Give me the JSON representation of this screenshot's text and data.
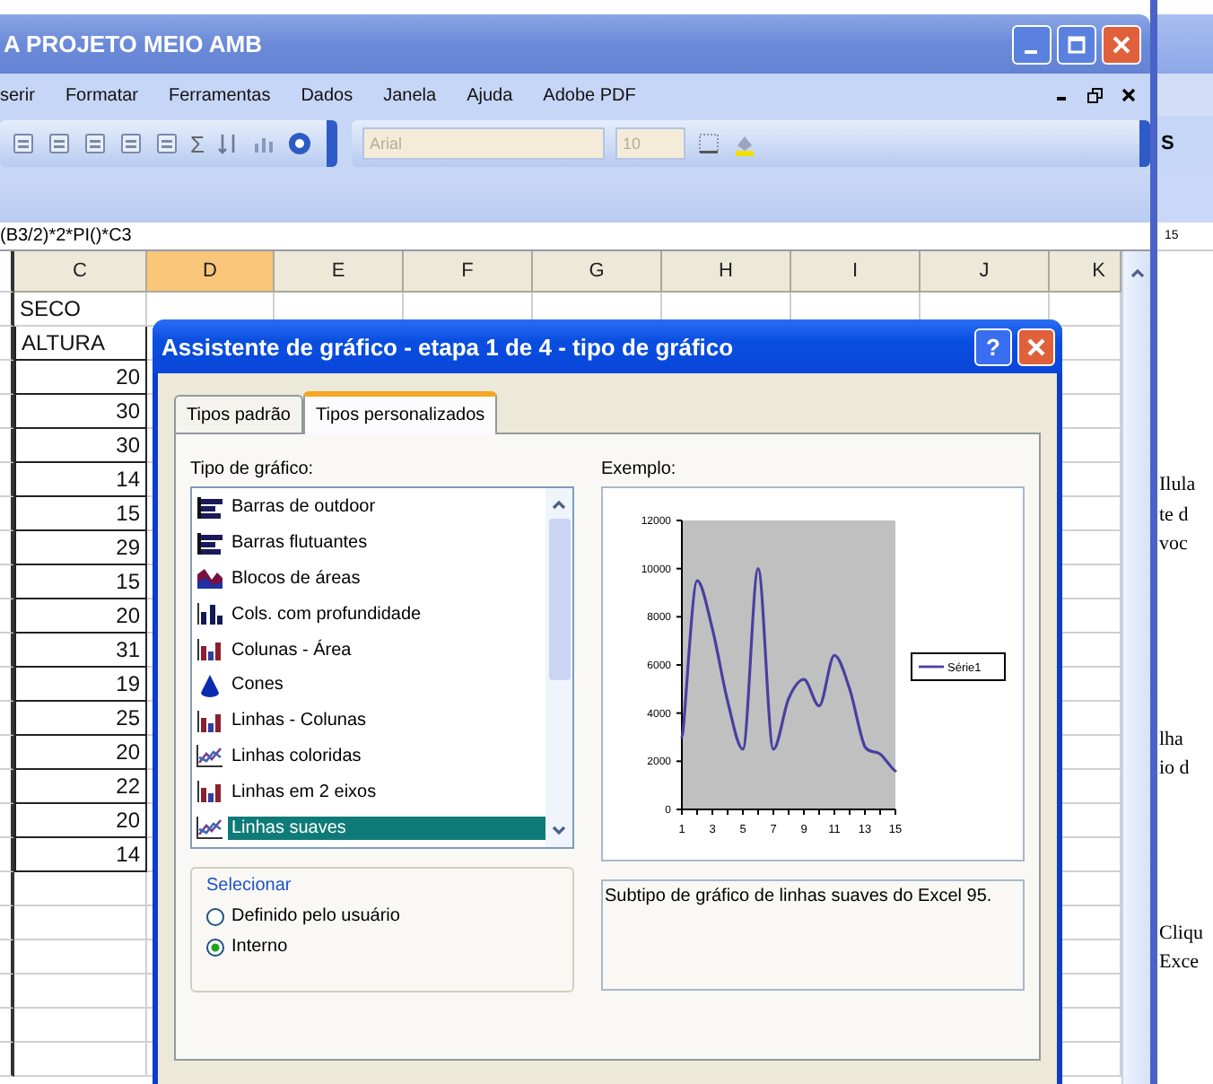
{
  "window": {
    "title": "A PROJETO MEIO AMB"
  },
  "menu": [
    "serir",
    "Formatar",
    "Ferramentas",
    "Dados",
    "Janela",
    "Ajuda",
    "Adobe PDF"
  ],
  "toolbar": {
    "sum_symbol": "Σ",
    "font": "Arial",
    "size": "10"
  },
  "formula_bar": {
    "formula": "(B3/2)*2*PI()*C3"
  },
  "sheet": {
    "columns": [
      {
        "label": "C",
        "selected": false
      },
      {
        "label": "D",
        "selected": true
      },
      {
        "label": "E",
        "selected": false
      },
      {
        "label": "F",
        "selected": false
      },
      {
        "label": "G",
        "selected": false
      },
      {
        "label": "H",
        "selected": false
      },
      {
        "label": "I",
        "selected": false
      },
      {
        "label": "J",
        "selected": false
      },
      {
        "label": "K",
        "selected": false
      }
    ],
    "column_c": [
      "SECO",
      "ALTURA",
      "20",
      "30",
      "30",
      "14",
      "15",
      "29",
      "15",
      "20",
      "31",
      "19",
      "25",
      "20",
      "22",
      "20",
      "14"
    ]
  },
  "dialog": {
    "title": "Assistente de gráfico - etapa 1 de 4 - tipo de gráfico",
    "help": "?",
    "tabs": [
      {
        "label": "Tipos padrão",
        "selected": false
      },
      {
        "label": "Tipos personalizados",
        "selected": true
      }
    ],
    "list_label": "Tipo de gráfico:",
    "chart_types": [
      {
        "label": "Barras de outdoor",
        "kind": "bar",
        "selected": false
      },
      {
        "label": "Barras flutuantes",
        "kind": "bar",
        "selected": false
      },
      {
        "label": "Blocos de áreas",
        "kind": "area",
        "selected": false
      },
      {
        "label": "Cols. com profundidade",
        "kind": "column",
        "selected": false
      },
      {
        "label": "Colunas - Área",
        "kind": "combo",
        "selected": false
      },
      {
        "label": "Cones",
        "kind": "cone",
        "selected": false
      },
      {
        "label": "Linhas - Colunas",
        "kind": "combo",
        "selected": false
      },
      {
        "label": "Linhas coloridas",
        "kind": "line",
        "selected": false
      },
      {
        "label": "Linhas em 2 eixos",
        "kind": "combo",
        "selected": false
      },
      {
        "label": "Linhas suaves",
        "kind": "line",
        "selected": true
      }
    ],
    "select_group": {
      "title": "Selecionar",
      "options": [
        {
          "label": "Definido pelo usuário",
          "selected": false
        },
        {
          "label": "Interno",
          "selected": true
        }
      ]
    },
    "example_label": "Exemplo:",
    "example": {
      "chart_data": {
        "type": "line",
        "x": [
          1,
          2,
          3,
          4,
          5,
          6,
          7,
          8,
          9,
          10,
          11,
          12,
          13,
          14,
          15
        ],
        "series": [
          {
            "name": "Série1",
            "color": "#4a3fa0",
            "values": [
              3000,
              9500,
              7500,
              4500,
              2500,
              10000,
              2500,
              4600,
              5400,
              4300,
              6400,
              5000,
              2600,
              2300,
              1600
            ]
          }
        ],
        "ylim": [
          0,
          12000
        ],
        "yticks": [
          0,
          2000,
          4000,
          6000,
          8000,
          10000,
          12000
        ],
        "xlim": [
          1,
          15
        ],
        "xticks": [
          1,
          3,
          5,
          7,
          9,
          11,
          13,
          15
        ]
      }
    },
    "description": "Subtipo de gráfico de linhas suaves do Excel 95."
  },
  "word_window": {
    "toolbar_button": "S",
    "ruler": "15",
    "paragraphs": [
      [
        "Ilula",
        "te d",
        "voc"
      ],
      [
        "lha",
        "io d"
      ],
      [
        "Cliqu",
        "Exce"
      ]
    ]
  }
}
